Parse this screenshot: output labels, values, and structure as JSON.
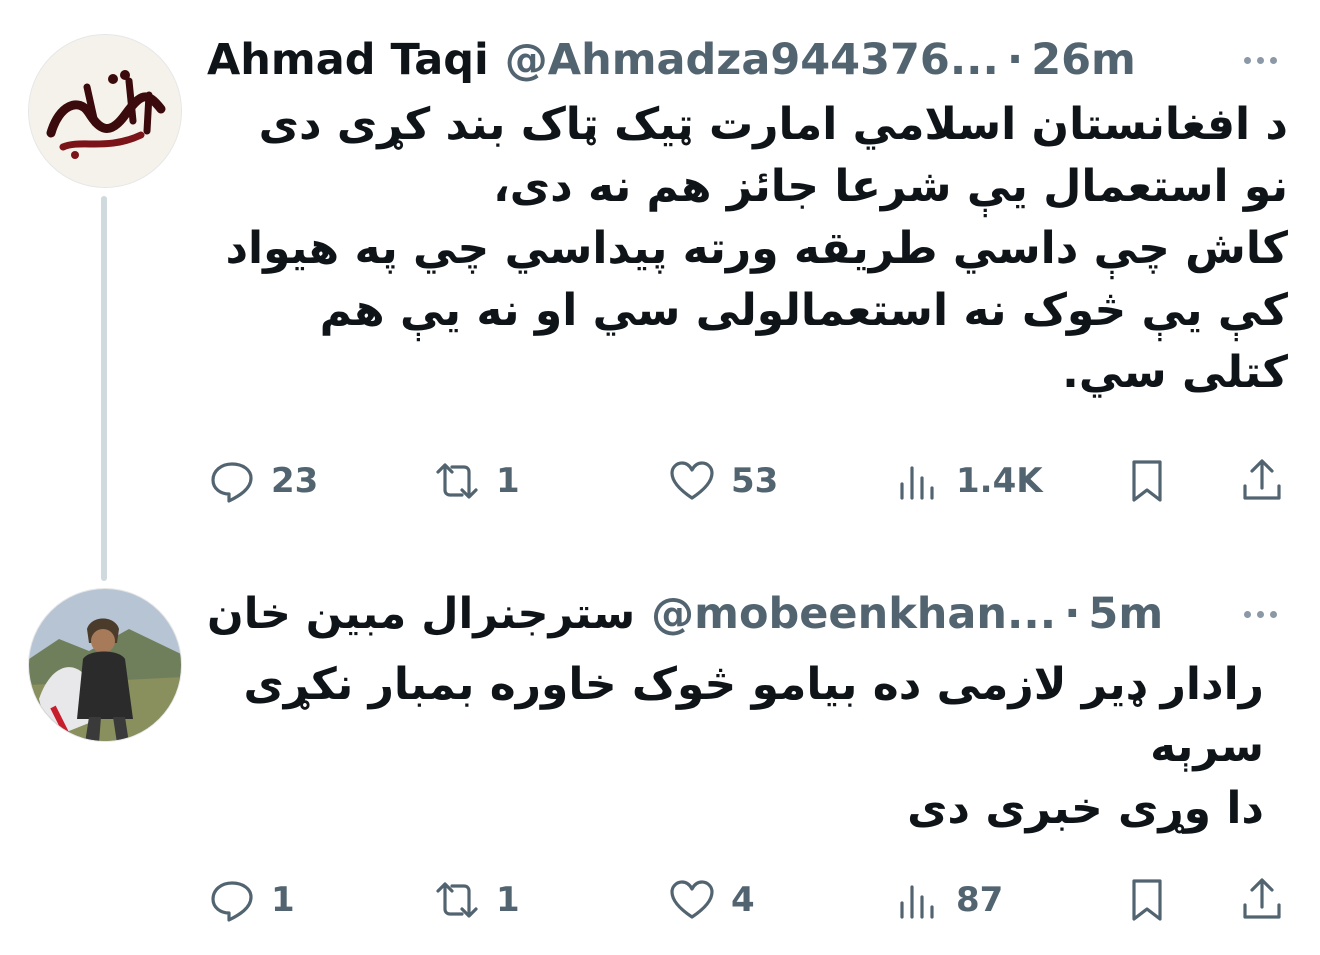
{
  "tweets": [
    {
      "author_name": "Ahmad Taqi",
      "handle": "@Ahmadza944376...",
      "separator": "·",
      "time": "26m",
      "avatar_text": "احمدتقی",
      "body_lines": [
        "د افغانستان اسلامي امارت ټيک ټاک بند کړی دی",
        "نو استعمال يې شرعا جائز هم نه دی،",
        "کاش چې داسي طريقه ورته پيداسي چي په هيواد",
        "کې يې څوک نه استعمالولی سي او نه يې هم",
        "کتلی سي."
      ],
      "stats": {
        "replies": "23",
        "retweets": "1",
        "likes": "53",
        "views": "1.4K"
      }
    },
    {
      "author_name": "سترجنرال مبين خان",
      "handle": "@mobeenkhan...",
      "separator": "·",
      "time": "5m",
      "body_lines": [
        "رادار ډير لازمی ده بيامو څوک خاوره بمبار نکړی",
        "سرېه",
        "دا وړی خبری دی"
      ],
      "stats": {
        "replies": "1",
        "retweets": "1",
        "likes": "4",
        "views": "87"
      }
    }
  ],
  "icons": {
    "reply": "reply-icon",
    "retweet": "retweet-icon",
    "like": "heart-icon",
    "views": "views-icon",
    "bookmark": "bookmark-icon",
    "share": "share-icon",
    "more": "more-icon"
  },
  "colors": {
    "text": "#0f1419",
    "secondary": "#536471",
    "thread_line": "#cfd9de",
    "avatar_script": "#7a1418"
  }
}
